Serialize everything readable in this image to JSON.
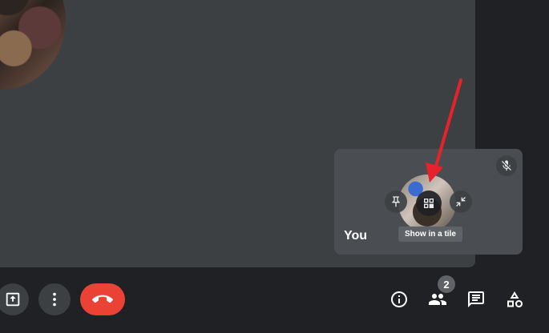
{
  "self_tile": {
    "label": "You",
    "tooltip": "Show in a tile",
    "buttons": [
      {
        "name": "pin",
        "icon": "pin-icon"
      },
      {
        "name": "show-in-tile",
        "icon": "grid-icon"
      },
      {
        "name": "minimize",
        "icon": "minimize-icon"
      }
    ],
    "mic_status_icon": "mic-off-icon"
  },
  "controls": {
    "left": [
      {
        "name": "present",
        "icon": "present-icon"
      },
      {
        "name": "more-options",
        "icon": "more-vert-icon"
      },
      {
        "name": "leave-call",
        "icon": "call-end-icon"
      }
    ],
    "right": [
      {
        "name": "meeting-details",
        "icon": "info-icon"
      },
      {
        "name": "people",
        "icon": "people-icon",
        "badge": "2"
      },
      {
        "name": "chat",
        "icon": "chat-icon"
      },
      {
        "name": "activities",
        "icon": "shapes-icon"
      }
    ]
  },
  "colors": {
    "background": "#202124",
    "tile": "#3c4043",
    "end_call": "#ea4335",
    "annotation_arrow": "#e8222a"
  }
}
